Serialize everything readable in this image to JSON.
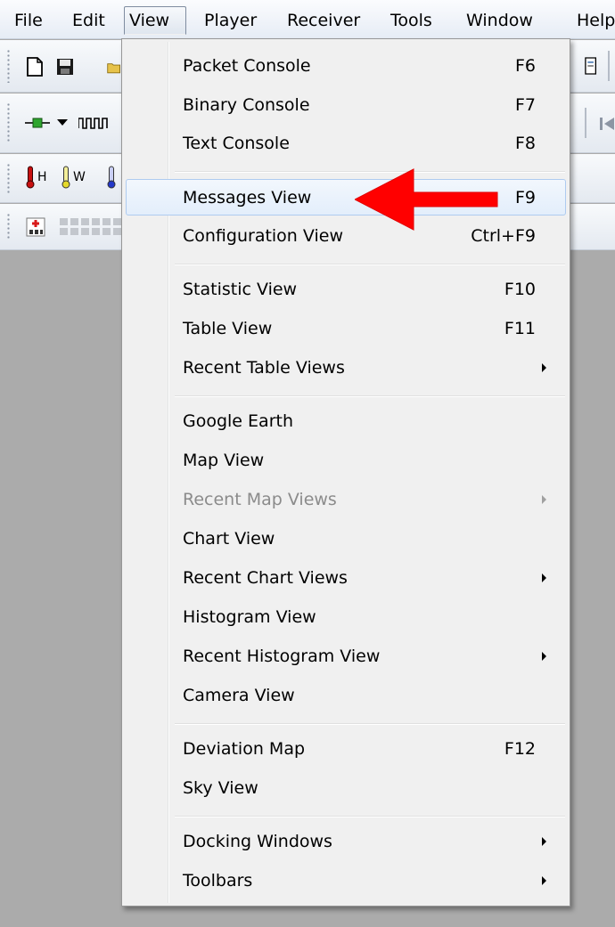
{
  "menubar": {
    "items": [
      "File",
      "Edit",
      "View",
      "Player",
      "Receiver",
      "Tools",
      "Window",
      "Help"
    ],
    "active": "View"
  },
  "toolbars": {
    "thermometer_labels": [
      "H",
      "W"
    ]
  },
  "view_menu": {
    "items": [
      {
        "label": "Packet Console",
        "shortcut": "F6"
      },
      {
        "label": "Binary Console",
        "shortcut": "F7"
      },
      {
        "label": "Text Console",
        "shortcut": "F8"
      },
      {
        "label": "Messages View",
        "shortcut": "F9",
        "highlighted": true
      },
      {
        "label": "Configuration View",
        "shortcut": "Ctrl+F9"
      },
      {
        "label": "Statistic View",
        "shortcut": "F10"
      },
      {
        "label": "Table View",
        "shortcut": "F11"
      },
      {
        "label": "Recent Table Views",
        "submenu": true
      },
      {
        "label": "Google Earth"
      },
      {
        "label": "Map View"
      },
      {
        "label": "Recent Map Views",
        "submenu": true,
        "disabled": true
      },
      {
        "label": "Chart View"
      },
      {
        "label": "Recent Chart Views",
        "submenu": true
      },
      {
        "label": "Histogram View"
      },
      {
        "label": "Recent Histogram View",
        "submenu": true
      },
      {
        "label": "Camera View"
      },
      {
        "label": "Deviation Map",
        "shortcut": "F12"
      },
      {
        "label": "Sky View"
      },
      {
        "label": "Docking Windows",
        "submenu": true
      },
      {
        "label": "Toolbars",
        "submenu": true
      }
    ]
  },
  "colors": {
    "annotation_arrow": "#ff0000",
    "workspace": "#ababab",
    "menu_background": "#f0f0f0",
    "highlight_border": "#aecbf0"
  }
}
